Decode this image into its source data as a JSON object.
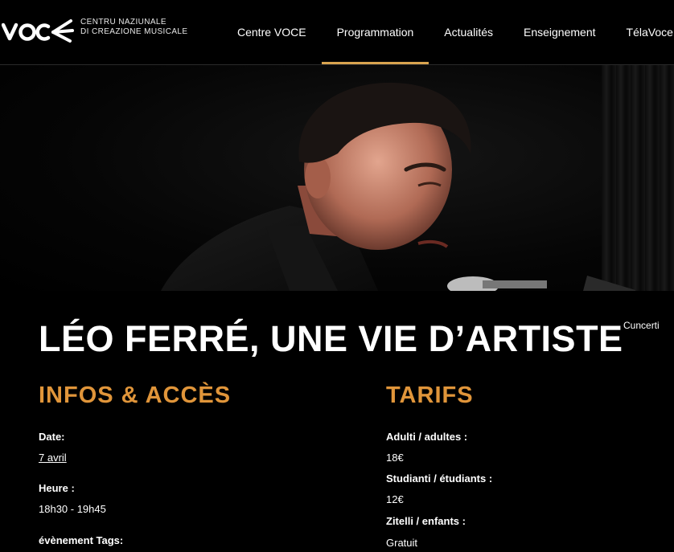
{
  "logo": {
    "wordmark": "VOCE",
    "line1": "CENTRU NAZIUNALE",
    "line2": "DI CREAZIONE MUSICALE"
  },
  "nav": {
    "items": [
      {
        "label": "Centre VOCE"
      },
      {
        "label": "Programmation"
      },
      {
        "label": "Actualités"
      },
      {
        "label": "Enseignement"
      },
      {
        "label": "TélaVoce"
      }
    ],
    "active_index": 1
  },
  "event": {
    "title": "LÉO FERRÉ, UNE VIE D’ARTISTE",
    "category": "Cuncerti"
  },
  "infos": {
    "heading": "INFOS & ACCÈS",
    "date_label": "Date:",
    "date_value": "7 avril",
    "time_label": "Heure :",
    "time_value": "18h30 - 19h45",
    "tags_label": "évènement Tags:"
  },
  "tarifs": {
    "heading": "TARIFS",
    "items": [
      {
        "label": "Adulti / adultes :",
        "value": "18€"
      },
      {
        "label": "Studianti / étudiants :",
        "value": "12€"
      },
      {
        "label": "Zitelli / enfants :",
        "value": "Gratuit"
      }
    ]
  },
  "colors": {
    "accent": "#e0953a",
    "nav_underline": "#d9a44f",
    "background": "#000000"
  }
}
